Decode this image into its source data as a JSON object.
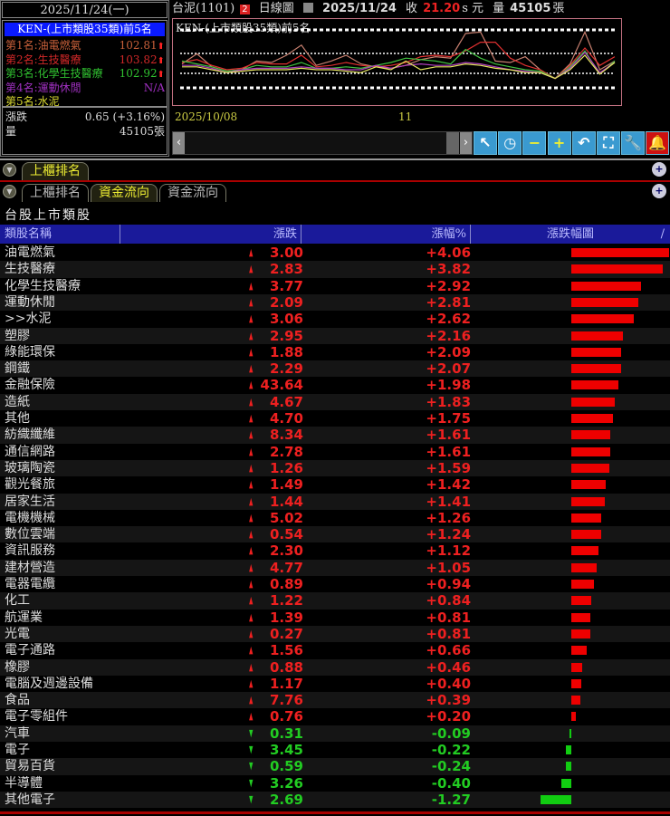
{
  "left": {
    "date": "2025/11/24(一)",
    "rank_title": "KEN-(上市類股35類)前5名",
    "ranks": [
      {
        "label": "第1名:油電燃氣",
        "value": "102.81",
        "color": "#c8603a",
        "up": true
      },
      {
        "label": "第2名:生技醫療",
        "value": "103.82",
        "color": "#d02828",
        "up": true
      },
      {
        "label": "第3名:化學生技醫療",
        "value": "102.92",
        "color": "#30c030",
        "up": true
      },
      {
        "label": "第4名:運動休閒",
        "value": "N/A",
        "color": "#a030c0",
        "up": false
      },
      {
        "label": "第5名:水泥",
        "value": "",
        "color": "#d8d830",
        "up": false
      }
    ],
    "change_label": "漲跌",
    "change_value": "0.65 (+3.16%)",
    "volume_label": "量",
    "volume_value": "45105張"
  },
  "titlebar": {
    "stock": "台泥(1101)",
    "badge": "2",
    "chart_type": "日線圖",
    "date": "2025/11/24",
    "close_label": "收",
    "close": "21.20",
    "close_suffix": "s 元",
    "vol_label": "量",
    "vol": "45105",
    "vol_unit": "張"
  },
  "mini_chart": {
    "title": "KEN-(上市類股35類)前5名",
    "x_labels": [
      "2025/10/08",
      "11"
    ],
    "series": [
      {
        "color": "#c88070",
        "values": [
          48,
          62,
          44,
          38,
          40,
          52,
          50,
          60,
          74,
          46,
          52,
          60,
          48,
          44,
          42,
          46,
          54,
          58,
          56,
          90,
          92,
          52,
          50,
          58,
          40,
          28,
          48,
          92,
          40,
          52
        ]
      },
      {
        "color": "#e03030",
        "values": [
          50,
          54,
          46,
          40,
          42,
          50,
          48,
          48,
          60,
          44,
          46,
          50,
          46,
          44,
          46,
          50,
          58,
          60,
          58,
          66,
          78,
          78,
          56,
          46,
          40,
          28,
          46,
          70,
          46,
          58
        ]
      },
      {
        "color": "#40c040",
        "values": [
          52,
          48,
          44,
          38,
          40,
          46,
          44,
          44,
          50,
          42,
          42,
          44,
          42,
          46,
          50,
          56,
          54,
          52,
          48,
          68,
          56,
          48,
          44,
          40,
          38,
          28,
          44,
          66,
          34,
          52
        ]
      },
      {
        "color": "#b040c0",
        "values": [
          46,
          46,
          42,
          36,
          40,
          42,
          42,
          42,
          44,
          42,
          42,
          40,
          40,
          46,
          42,
          46,
          48,
          46,
          46,
          50,
          48,
          44,
          40,
          38,
          36,
          28,
          42,
          64,
          36,
          50
        ]
      },
      {
        "color": "#e8e860",
        "values": [
          44,
          44,
          40,
          36,
          38,
          40,
          40,
          40,
          42,
          40,
          40,
          38,
          36,
          44,
          40,
          52,
          40,
          44,
          44,
          48,
          46,
          42,
          40,
          36,
          36,
          28,
          40,
          60,
          34,
          50
        ]
      }
    ]
  },
  "toolbar": {
    "buttons": [
      "arrow-icon",
      "clock-icon",
      "minus-icon",
      "plus-icon",
      "undo-icon",
      "fit-icon",
      "wrench-icon",
      "bell-icon"
    ]
  },
  "tabs_top": {
    "tab": "上櫃排名"
  },
  "tabs": [
    "上櫃排名",
    "資金流向",
    "資金流向"
  ],
  "section_title": "台股上市類股",
  "table": {
    "headers": [
      "類股名稱",
      "漲跌",
      "漲幅%",
      "漲跌幅圖"
    ],
    "header_end": "/",
    "rows": [
      {
        "name": "油電燃氣",
        "chg": "3.00",
        "pct": "+4.06",
        "p": 4.06
      },
      {
        "name": "生技醫療",
        "chg": "2.83",
        "pct": "+3.82",
        "p": 3.82
      },
      {
        "name": "化學生技醫療",
        "chg": "3.77",
        "pct": "+2.92",
        "p": 2.92
      },
      {
        "name": "運動休閒",
        "chg": "2.09",
        "pct": "+2.81",
        "p": 2.81
      },
      {
        "name": ">>水泥",
        "chg": "3.06",
        "pct": "+2.62",
        "p": 2.62
      },
      {
        "name": "塑膠",
        "chg": "2.95",
        "pct": "+2.16",
        "p": 2.16
      },
      {
        "name": "綠能環保",
        "chg": "1.88",
        "pct": "+2.09",
        "p": 2.09
      },
      {
        "name": "鋼鐵",
        "chg": "2.29",
        "pct": "+2.07",
        "p": 2.07
      },
      {
        "name": "金融保險",
        "chg": "43.64",
        "pct": "+1.98",
        "p": 1.98
      },
      {
        "name": "造紙",
        "chg": "4.67",
        "pct": "+1.83",
        "p": 1.83
      },
      {
        "name": "其他",
        "chg": "4.70",
        "pct": "+1.75",
        "p": 1.75
      },
      {
        "name": "紡織纖維",
        "chg": "8.34",
        "pct": "+1.61",
        "p": 1.61
      },
      {
        "name": "通信網路",
        "chg": "2.78",
        "pct": "+1.61",
        "p": 1.61
      },
      {
        "name": "玻璃陶瓷",
        "chg": "1.26",
        "pct": "+1.59",
        "p": 1.59
      },
      {
        "name": "觀光餐旅",
        "chg": "1.49",
        "pct": "+1.42",
        "p": 1.42
      },
      {
        "name": "居家生活",
        "chg": "1.44",
        "pct": "+1.41",
        "p": 1.41
      },
      {
        "name": "電機機械",
        "chg": "5.02",
        "pct": "+1.26",
        "p": 1.26
      },
      {
        "name": "數位雲端",
        "chg": "0.54",
        "pct": "+1.24",
        "p": 1.24
      },
      {
        "name": "資訊服務",
        "chg": "2.30",
        "pct": "+1.12",
        "p": 1.12
      },
      {
        "name": "建材營造",
        "chg": "4.77",
        "pct": "+1.05",
        "p": 1.05
      },
      {
        "name": "電器電纜",
        "chg": "0.89",
        "pct": "+0.94",
        "p": 0.94
      },
      {
        "name": "化工",
        "chg": "1.22",
        "pct": "+0.84",
        "p": 0.84
      },
      {
        "name": "航運業",
        "chg": "1.39",
        "pct": "+0.81",
        "p": 0.81
      },
      {
        "name": "光電",
        "chg": "0.27",
        "pct": "+0.81",
        "p": 0.81
      },
      {
        "name": "電子通路",
        "chg": "1.56",
        "pct": "+0.66",
        "p": 0.66
      },
      {
        "name": "橡膠",
        "chg": "0.88",
        "pct": "+0.46",
        "p": 0.46
      },
      {
        "name": "電腦及週邊設備",
        "chg": "1.17",
        "pct": "+0.40",
        "p": 0.4
      },
      {
        "name": "食品",
        "chg": "7.76",
        "pct": "+0.39",
        "p": 0.39
      },
      {
        "name": "電子零組件",
        "chg": "0.76",
        "pct": "+0.20",
        "p": 0.2
      },
      {
        "name": "汽車",
        "chg": "0.31",
        "pct": "-0.09",
        "p": -0.09
      },
      {
        "name": "電子",
        "chg": "3.45",
        "pct": "-0.22",
        "p": -0.22
      },
      {
        "name": "貿易百貨",
        "chg": "0.59",
        "pct": "-0.24",
        "p": -0.24
      },
      {
        "name": "半導體",
        "chg": "3.26",
        "pct": "-0.40",
        "p": -0.4
      },
      {
        "name": "其他電子",
        "chg": "2.69",
        "pct": "-1.27",
        "p": -1.27
      }
    ]
  },
  "colors": {
    "up": "#ee2020",
    "down": "#22cc22",
    "bar_up": "#ee0000",
    "bar_down": "#11cc11"
  }
}
